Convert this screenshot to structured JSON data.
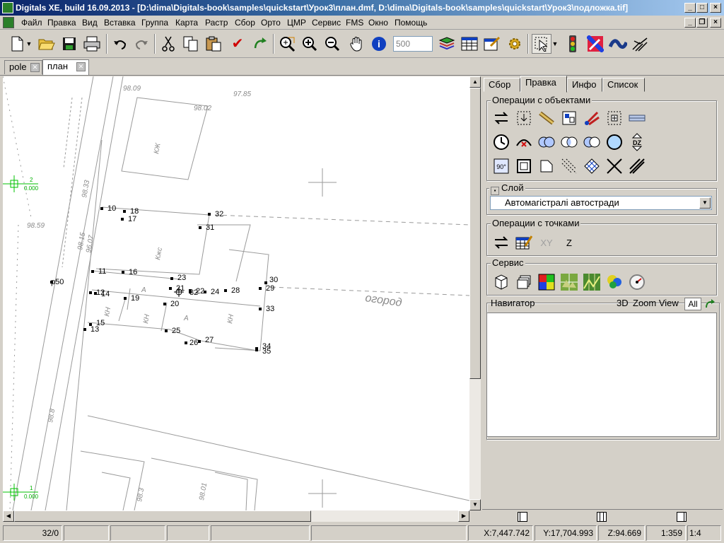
{
  "window": {
    "title": "Digitals XE, build 16.09.2013 - [D:\\dima\\Digitals-book\\samples\\quickstart\\Урок3\\план.dmf, D:\\dima\\Digitals-book\\samples\\quickstart\\Урок3\\подложка.tif]",
    "controls": [
      "_",
      "□",
      "×"
    ],
    "mdi_controls": [
      "_",
      "❐",
      "×"
    ]
  },
  "menu": [
    {
      "label": "Файл"
    },
    {
      "label": "Правка"
    },
    {
      "label": "Вид"
    },
    {
      "label": "Вставка"
    },
    {
      "label": "Группа"
    },
    {
      "label": "Карта"
    },
    {
      "label": "Растр"
    },
    {
      "label": "Сбор"
    },
    {
      "label": "Орто"
    },
    {
      "label": "ЦМР"
    },
    {
      "label": "Сервис"
    },
    {
      "label": "FMS"
    },
    {
      "label": "Окно"
    },
    {
      "label": "Помощь"
    }
  ],
  "toolbar": {
    "scale_value": "500",
    "buttons": [
      "new-file-icon",
      "open-folder-icon",
      "save-icon",
      "print-icon",
      "undo-icon",
      "redo-icon",
      "cut-icon",
      "copy-icon",
      "paste-icon",
      "check-icon",
      "refresh-icon",
      "zoom-window-icon",
      "zoom-in-icon",
      "zoom-out-icon",
      "pan-hand-icon",
      "info-icon",
      "layers-icon",
      "table-icon",
      "properties-icon",
      "settings-icon",
      "select-cursor-icon",
      "traffic-light-icon",
      "draw-pen-icon",
      "curve-icon",
      "snap-icon"
    ]
  },
  "doc_tabs": [
    {
      "label": "pole",
      "active": false
    },
    {
      "label": "план",
      "active": true
    }
  ],
  "map": {
    "points": [
      {
        "label": "10"
      },
      {
        "label": "18"
      },
      {
        "label": "32"
      },
      {
        "label": "17"
      },
      {
        "label": "31"
      },
      {
        "label": "11"
      },
      {
        "label": "16"
      },
      {
        "label": "23"
      },
      {
        "label": "p50"
      },
      {
        "label": "30"
      },
      {
        "label": "21"
      },
      {
        "label": "22"
      },
      {
        "label": "24"
      },
      {
        "label": "28"
      },
      {
        "label": "29"
      },
      {
        "label": "12"
      },
      {
        "label": "14"
      },
      {
        "label": "19"
      },
      {
        "label": "20"
      },
      {
        "label": "33"
      },
      {
        "label": "15"
      },
      {
        "label": "13"
      },
      {
        "label": "25"
      },
      {
        "label": "26"
      },
      {
        "label": "27"
      },
      {
        "label": "34"
      },
      {
        "label": "35"
      },
      {
        "label": "32"
      }
    ],
    "grid_markers": [
      {
        "top": "2",
        "bottom": "0.000"
      },
      {
        "top": "1",
        "bottom": "0.000"
      }
    ],
    "raster_labels": [
      "98.09",
      "97.85",
      "98.02",
      "98.33",
      "98.59",
      "96.07",
      "98.15",
      "98.8",
      "98.3",
      "98.01",
      "огород",
      "КЖ",
      "Кжс",
      "КН",
      "КН",
      "А",
      "А",
      "КН"
    ]
  },
  "panel": {
    "tabs": [
      {
        "label": "Сбор",
        "active": false
      },
      {
        "label": "Правка",
        "active": true
      },
      {
        "label": "Инфо",
        "active": false
      },
      {
        "label": "Список",
        "active": false
      }
    ],
    "object_ops_title": "Операции с объектами",
    "layer_title": "Слой",
    "layer_value": "Автомагістралі автостради",
    "point_ops_title": "Операции с точками",
    "point_ops": [
      "swap-icon",
      "table-edit-icon",
      "XY",
      "Z"
    ],
    "service_title": "Сервис",
    "navigator_title": "Навигатор",
    "navigator_3d": "3D",
    "navigator_zoom": "Zoom View",
    "navigator_all": "All"
  },
  "status": {
    "count": "32/0",
    "x": "X:7,447.742",
    "y": "Y:17,704.993",
    "z": "Z:94.669",
    "scale": "1:359",
    "ratio": "1:4"
  }
}
